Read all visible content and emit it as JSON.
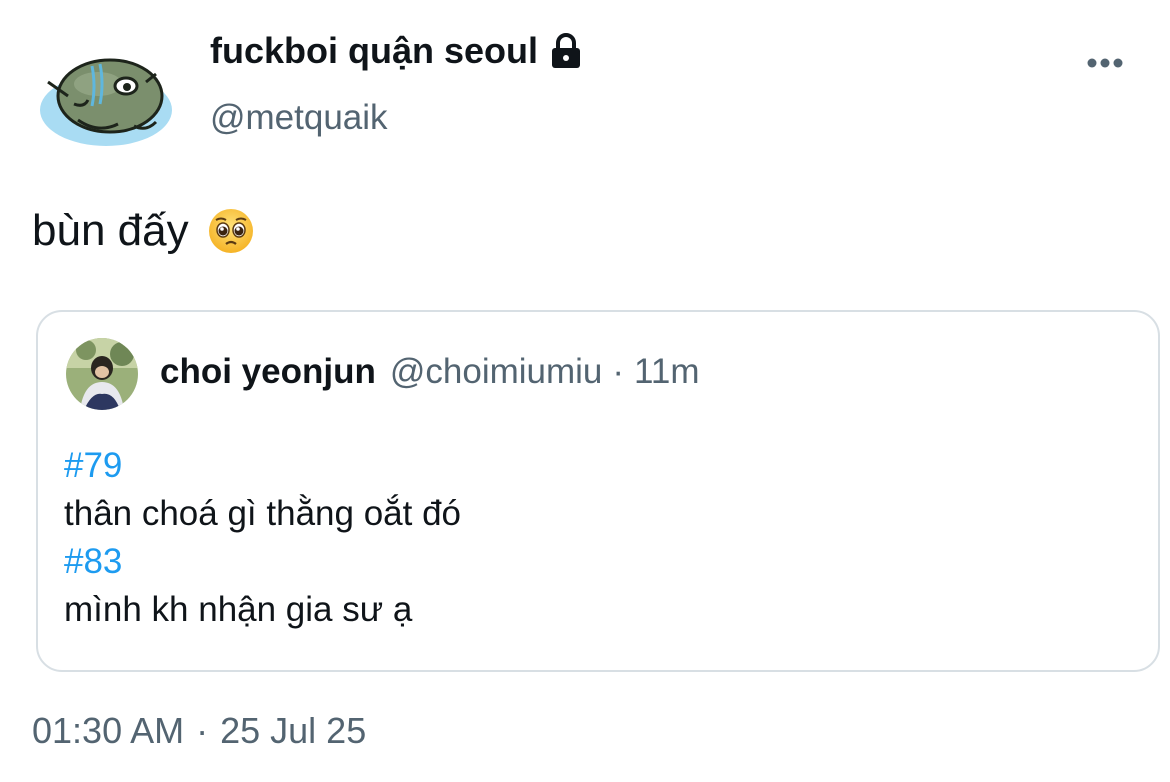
{
  "author": {
    "display_name": "fuckboi quận seoul",
    "handle": "@metquaik",
    "avatar_icon": "seal-sticker-avatar",
    "lock_icon": "lock-icon"
  },
  "tweet": {
    "text": "bùn đấy",
    "emoji_icon": "pleading-face-emoji"
  },
  "quote": {
    "display_name": "choi yeonjun",
    "handle": "@choimiumiu",
    "separator": "·",
    "time": "11m",
    "lines": [
      {
        "text": "#79",
        "type": "hashtag"
      },
      {
        "text": "thân choá gì thằng oắt đó",
        "type": "text"
      },
      {
        "text": "#83",
        "type": "hashtag"
      },
      {
        "text": "mình kh nhận gia sư ạ",
        "type": "text"
      }
    ]
  },
  "timestamp": {
    "time": "01:30 AM",
    "separator": "·",
    "date": "25 Jul 25"
  },
  "colors": {
    "text_primary": "#0f1419",
    "text_secondary": "#536471",
    "hashtag": "#1d9bf0",
    "border": "#d8dfe4"
  }
}
